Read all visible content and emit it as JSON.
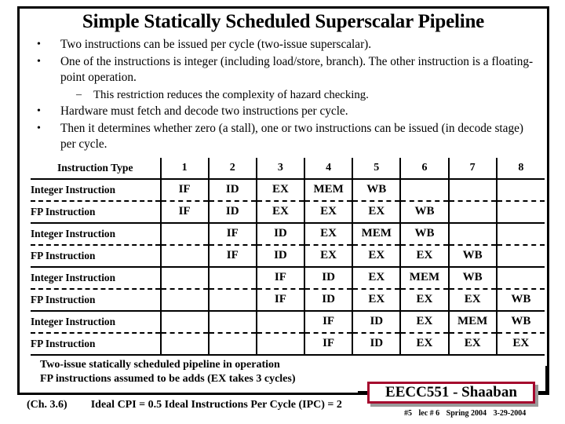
{
  "slide": {
    "title": "Simple Statically Scheduled Superscalar Pipeline",
    "bullets": [
      {
        "level": 1,
        "mark": "•",
        "text": "Two instructions can be issued per cycle (two-issue superscalar)."
      },
      {
        "level": 1,
        "mark": "•",
        "text": "One of the instructions is integer (including load/store, branch). The other instruction is a floating-point operation."
      },
      {
        "level": 2,
        "mark": "–",
        "text": "This restriction reduces the complexity of hazard checking."
      },
      {
        "level": 1,
        "mark": "•",
        "text": "Hardware must fetch and decode two instructions per cycle."
      },
      {
        "level": 1,
        "mark": "•",
        "text": "Then it determines whether zero (a stall),  one or two instructions can be issued (in decode stage) per cycle."
      }
    ]
  },
  "table": {
    "header_type": "Instruction Type",
    "cycles": [
      "1",
      "2",
      "3",
      "4",
      "5",
      "6",
      "7",
      "8"
    ],
    "rows": [
      {
        "type": "Integer Instruction",
        "stages": [
          "IF",
          "ID",
          "EX",
          "MEM",
          "WB",
          "",
          "",
          ""
        ],
        "sep": "dashed"
      },
      {
        "type": "FP Instruction",
        "stages": [
          "IF",
          "ID",
          "EX",
          "EX",
          "EX",
          "WB",
          "",
          ""
        ],
        "sep": "solid"
      },
      {
        "type": "Integer Instruction",
        "stages": [
          "",
          "IF",
          "ID",
          "EX",
          "MEM",
          "WB",
          "",
          ""
        ],
        "sep": "dashed"
      },
      {
        "type": "FP Instruction",
        "stages": [
          "",
          "IF",
          "ID",
          "EX",
          "EX",
          "EX",
          "WB",
          ""
        ],
        "sep": "solid"
      },
      {
        "type": "Integer Instruction",
        "stages": [
          "",
          "",
          "IF",
          "ID",
          "EX",
          "MEM",
          "WB",
          ""
        ],
        "sep": "dashed"
      },
      {
        "type": "FP Instruction",
        "stages": [
          "",
          "",
          "IF",
          "ID",
          "EX",
          "EX",
          "EX",
          "WB"
        ],
        "sep": "solid"
      },
      {
        "type": "Integer Instruction",
        "stages": [
          "",
          "",
          "",
          "IF",
          "ID",
          "EX",
          "MEM",
          "WB"
        ],
        "sep": "dashed"
      },
      {
        "type": "FP Instruction",
        "stages": [
          "",
          "",
          "",
          "IF",
          "ID",
          "EX",
          "EX",
          "EX"
        ],
        "sep": "last"
      }
    ]
  },
  "caption": {
    "line1": "Two-issue statically scheduled pipeline in operation",
    "line2": "FP instructions assumed to be adds (EX takes 3 cycles)"
  },
  "footer": {
    "chapter": "(Ch. 3.6)",
    "metrics": "Ideal CPI = 0.5  Ideal Instructions Per Cycle (IPC) = 2"
  },
  "logo": {
    "text": "EECC551 - Shaaban",
    "meta_slide": "#5",
    "meta_lecture": "lec # 6",
    "meta_term": "Spring 2004",
    "meta_date": "3-29-2004",
    "border_color": "#A5082E"
  }
}
